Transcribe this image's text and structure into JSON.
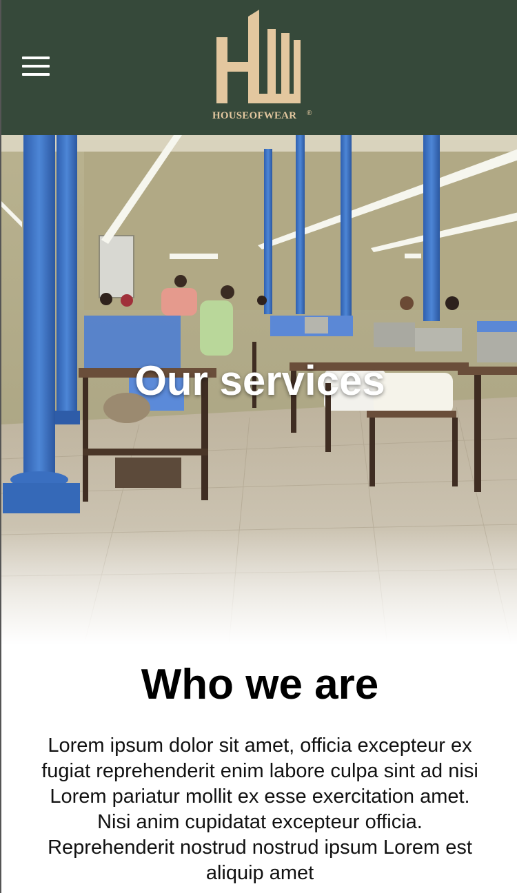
{
  "header": {
    "brand_name": "HOUSEOFWEAR",
    "registered_mark": "®",
    "menu_icon": "hamburger-menu-icon",
    "background_color": "#36493a",
    "logo_color": "#e3c79f"
  },
  "hero": {
    "title": "Our services",
    "image_subject": "garment-factory-workshop"
  },
  "about": {
    "title": "Who we are",
    "text": "Lorem ipsum dolor sit amet, officia excepteur ex fugiat reprehenderit enim labore culpa sint ad nisi Lorem pariatur mollit ex esse exercitation amet. Nisi anim cupidatat excepteur officia. Reprehenderit nostrud nostrud ipsum Lorem est aliquip amet"
  }
}
